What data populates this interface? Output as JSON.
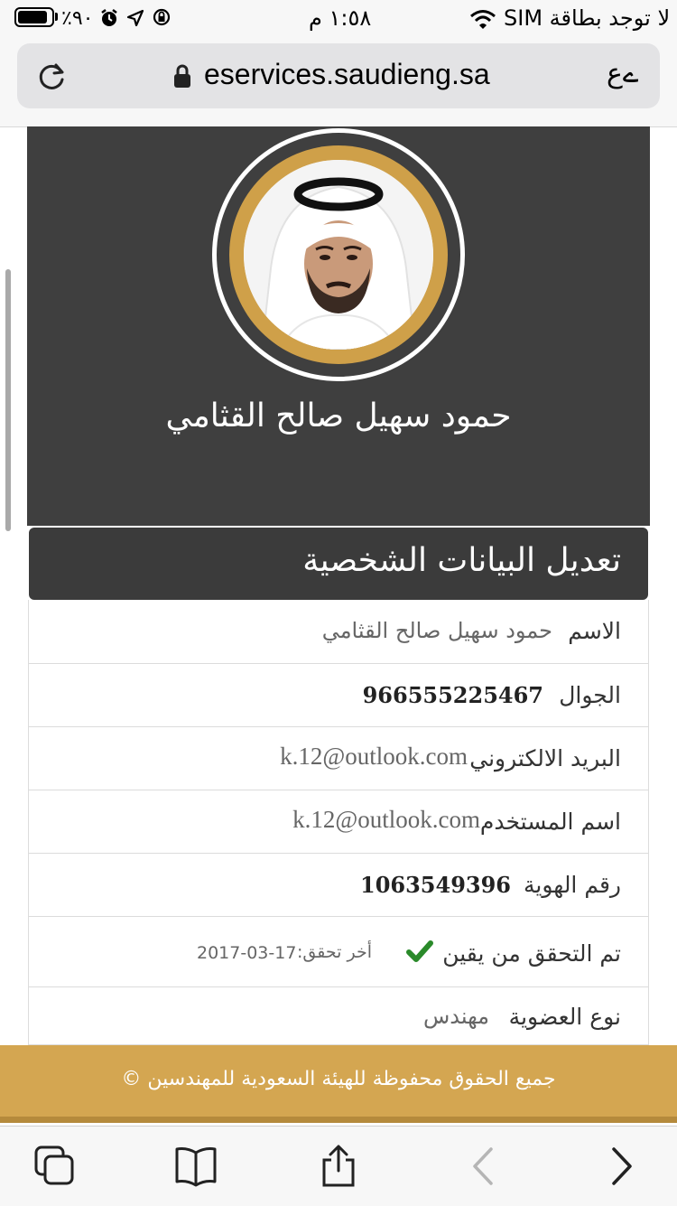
{
  "status_bar": {
    "carrier": "لا توجد بطاقة SIM",
    "time": "١:٥٨ م",
    "battery_percent": "٪٩٠",
    "battery_level": 0.9
  },
  "browser": {
    "text_size_label": "ےع",
    "url": "eservices.saudieng.sa"
  },
  "profile": {
    "name": "حمود سهيل صالح القثامي"
  },
  "section": {
    "title": "تعديل البيانات الشخصية"
  },
  "fields": {
    "name": {
      "label": "الاسم",
      "value": "حمود سهيل صالح القثامي"
    },
    "mobile": {
      "label": "الجوال",
      "value": "966555225467"
    },
    "email": {
      "label": "البريد الالكتروني",
      "value": "k.12@outlook.com"
    },
    "username": {
      "label": "اسم المستخدم",
      "value": "k.12@outlook.com"
    },
    "id_number": {
      "label": "رقم الهوية",
      "value": "1063549396"
    },
    "verification": {
      "label": "تم التحقق من يقين",
      "last_check_label": "أخر تحقق:",
      "last_check_date": "2017-03-17"
    },
    "membership": {
      "label": "نوع العضوية",
      "value": "مهندس"
    }
  },
  "footer": {
    "text": "جميع الحقوق محفوظة للهيئة السعودية للمهندسين ©"
  },
  "colors": {
    "gold": "#cfa049",
    "footer_gold": "#d4a651",
    "header_dark": "#3f3f3f",
    "check_green": "#2a8a2a"
  }
}
